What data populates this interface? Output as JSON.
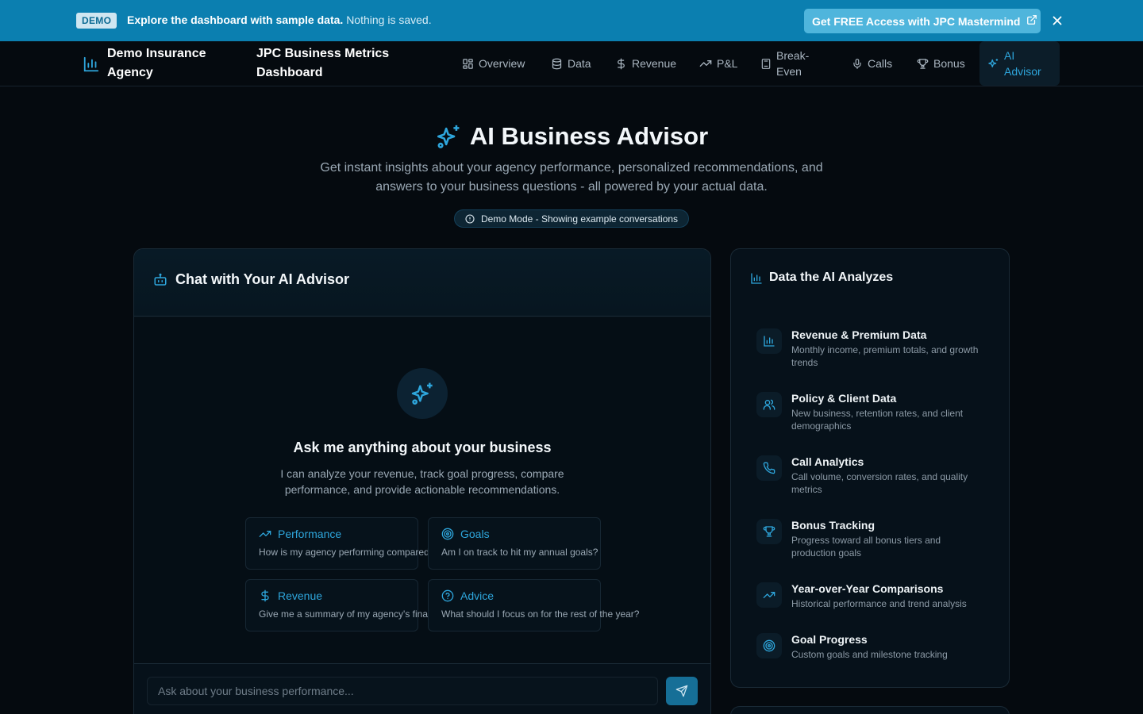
{
  "banner": {
    "tag": "DEMO",
    "message_bold": "Explore the dashboard with sample data.",
    "message_rest": "Nothing is saved.",
    "cta_label": "Get FREE Access with JPC Mastermind"
  },
  "nav": {
    "brand": "Demo Insurance Agency",
    "dashboard_title": "JPC Business Metrics Dashboard",
    "items": [
      {
        "label": "Overview",
        "icon": "grid-icon"
      },
      {
        "label": "Data",
        "icon": "database-icon"
      },
      {
        "label": "Revenue",
        "icon": "dollar-icon"
      },
      {
        "label": "P&L",
        "icon": "trending-up-icon"
      },
      {
        "label": "Break-Even",
        "icon": "calculator-icon"
      },
      {
        "label": "Calls",
        "icon": "microphone-icon"
      },
      {
        "label": "Bonus",
        "icon": "trophy-icon"
      },
      {
        "label": "AI Advisor",
        "icon": "sparkles-icon",
        "active": true
      }
    ]
  },
  "hero": {
    "title": "AI Business Advisor",
    "subtitle": "Get instant insights about your agency performance, personalized recommendations, and answers to your business questions - all powered by your actual data.",
    "demo_pill": "Demo Mode - Showing example conversations"
  },
  "chat": {
    "title": "Chat with Your AI Advisor",
    "empty_title": "Ask me anything about your business",
    "empty_subtitle": "I can analyze your revenue, track goal progress, compare performance, and provide actionable recommendations.",
    "suggestions": [
      {
        "label": "Performance",
        "text": "How is my agency performing compared to last year?",
        "icon": "trending-up-icon"
      },
      {
        "label": "Goals",
        "text": "Am I on track to hit my annual goals?",
        "icon": "target-icon"
      },
      {
        "label": "Revenue",
        "text": "Give me a summary of my agency's financial health",
        "icon": "dollar-icon"
      },
      {
        "label": "Advice",
        "text": "What should I focus on for the rest of the year?",
        "icon": "help-circle-icon"
      }
    ],
    "input_placeholder": "Ask about your business performance..."
  },
  "data_panel": {
    "title": "Data the AI Analyzes",
    "items": [
      {
        "title": "Revenue & Premium Data",
        "desc": "Monthly income, premium totals, and growth trends",
        "icon": "bar-chart-icon"
      },
      {
        "title": "Policy & Client Data",
        "desc": "New business, retention rates, and client demographics",
        "icon": "users-icon"
      },
      {
        "title": "Call Analytics",
        "desc": "Call volume, conversion rates, and quality metrics",
        "icon": "phone-icon"
      },
      {
        "title": "Bonus Tracking",
        "desc": "Progress toward all bonus tiers and production goals",
        "icon": "trophy-icon"
      },
      {
        "title": "Year-over-Year Comparisons",
        "desc": "Historical performance and trend analysis",
        "icon": "trending-up-icon"
      },
      {
        "title": "Goal Progress",
        "desc": "Custom goals and milestone tracking",
        "icon": "target-icon"
      }
    ]
  },
  "colors": {
    "banner": "#0b7fb0",
    "accent": "#2ea6dc",
    "background": "#050a0f"
  }
}
